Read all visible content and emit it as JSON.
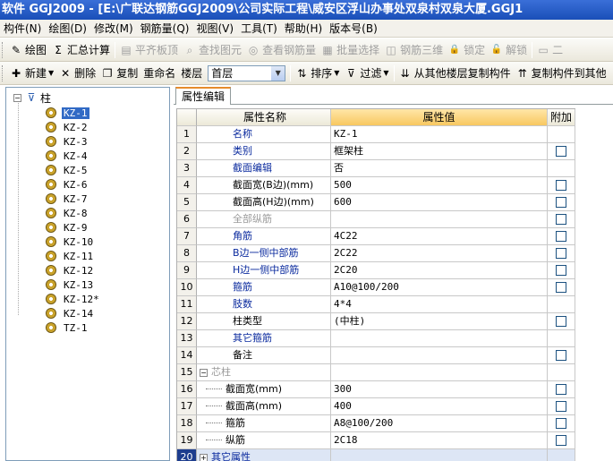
{
  "title": "软件 GGJ2009 - [E:\\广联达钢筋GGJ2009\\公司实际工程\\威安区浮山办事处双泉村双泉大厦.GGJ1",
  "menu": [
    "构件(N)",
    "绘图(D)",
    "修改(M)",
    "钢筋量(Q)",
    "视图(V)",
    "工具(T)",
    "帮助(H)",
    "版本号(B)"
  ],
  "toolbar1": [
    {
      "label": "绘图",
      "icon": "draw-icon",
      "enabled": true
    },
    {
      "label": "汇总计算",
      "icon": "sigma-icon",
      "enabled": true
    },
    {
      "label": "平齐板顶",
      "icon": "align-icon",
      "enabled": false
    },
    {
      "label": "查找图元",
      "icon": "find-icon",
      "enabled": false
    },
    {
      "label": "查看钢筋量",
      "icon": "view-icon",
      "enabled": false
    },
    {
      "label": "批量选择",
      "icon": "batch-icon",
      "enabled": false
    },
    {
      "label": "钢筋三维",
      "icon": "3d-icon",
      "enabled": false
    },
    {
      "label": "锁定",
      "icon": "lock-icon",
      "enabled": false
    },
    {
      "label": "解锁",
      "icon": "unlock-icon",
      "enabled": false
    },
    {
      "label": "二",
      "icon": "more-icon",
      "enabled": false
    }
  ],
  "toolbar2": {
    "new_label": "新建",
    "delete_label": "删除",
    "copy_label": "复制",
    "rename_label": "重命名",
    "floor_label": "楼层",
    "floor_value": "首层",
    "sort_label": "排序",
    "filter_label": "过滤",
    "copy_from_label": "从其他楼层复制构件",
    "copy_to_label": "复制构件到其他"
  },
  "tree": {
    "root": "柱",
    "items": [
      "KZ-1",
      "KZ-2",
      "KZ-3",
      "KZ-4",
      "KZ-5",
      "KZ-6",
      "KZ-7",
      "KZ-8",
      "KZ-9",
      "KZ-10",
      "KZ-11",
      "KZ-12",
      "KZ-13",
      "KZ-12*",
      "KZ-14",
      "TZ-1"
    ],
    "selected": 0
  },
  "tab": "属性编辑",
  "grid": {
    "headers": [
      "属性名称",
      "属性值",
      "附加"
    ],
    "rows": [
      {
        "n": "1",
        "name": "名称",
        "value": "KZ-1",
        "style": "blue",
        "check": false
      },
      {
        "n": "2",
        "name": "类别",
        "value": "框架柱",
        "style": "blue",
        "check": true
      },
      {
        "n": "3",
        "name": "截面编辑",
        "value": "否",
        "style": "blue",
        "check": false
      },
      {
        "n": "4",
        "name": "截面宽(B边)(mm)",
        "value": "500",
        "style": "",
        "check": true
      },
      {
        "n": "5",
        "name": "截面高(H边)(mm)",
        "value": "600",
        "style": "",
        "check": true
      },
      {
        "n": "6",
        "name": "全部纵筋",
        "value": "",
        "style": "gray",
        "check": true
      },
      {
        "n": "7",
        "name": "角筋",
        "value": "4C22",
        "style": "blue",
        "check": true
      },
      {
        "n": "8",
        "name": "B边一侧中部筋",
        "value": "2C22",
        "style": "blue",
        "check": true
      },
      {
        "n": "9",
        "name": "H边一侧中部筋",
        "value": "2C20",
        "style": "blue",
        "check": true
      },
      {
        "n": "10",
        "name": "箍筋",
        "value": "A10@100/200",
        "style": "blue",
        "check": true
      },
      {
        "n": "11",
        "name": "肢数",
        "value": "4*4",
        "style": "blue",
        "check": false
      },
      {
        "n": "12",
        "name": "柱类型",
        "value": "(中柱)",
        "style": "",
        "check": true
      },
      {
        "n": "13",
        "name": "其它箍筋",
        "value": "",
        "style": "blue",
        "check": false
      },
      {
        "n": "14",
        "name": "备注",
        "value": "",
        "style": "",
        "check": true
      },
      {
        "n": "15",
        "name": "芯柱",
        "value": "",
        "style": "gray-group",
        "check": false
      },
      {
        "n": "16",
        "name": "截面宽(mm)",
        "value": "300",
        "style": "sub",
        "check": true
      },
      {
        "n": "17",
        "name": "截面高(mm)",
        "value": "400",
        "style": "sub",
        "check": true
      },
      {
        "n": "18",
        "name": "箍筋",
        "value": "A8@100/200",
        "style": "sub",
        "check": true
      },
      {
        "n": "19",
        "name": "纵筋",
        "value": "2C18",
        "style": "sub",
        "check": true
      },
      {
        "n": "20",
        "name": "其它属性",
        "value": "",
        "style": "selected-group",
        "check": false
      }
    ]
  }
}
